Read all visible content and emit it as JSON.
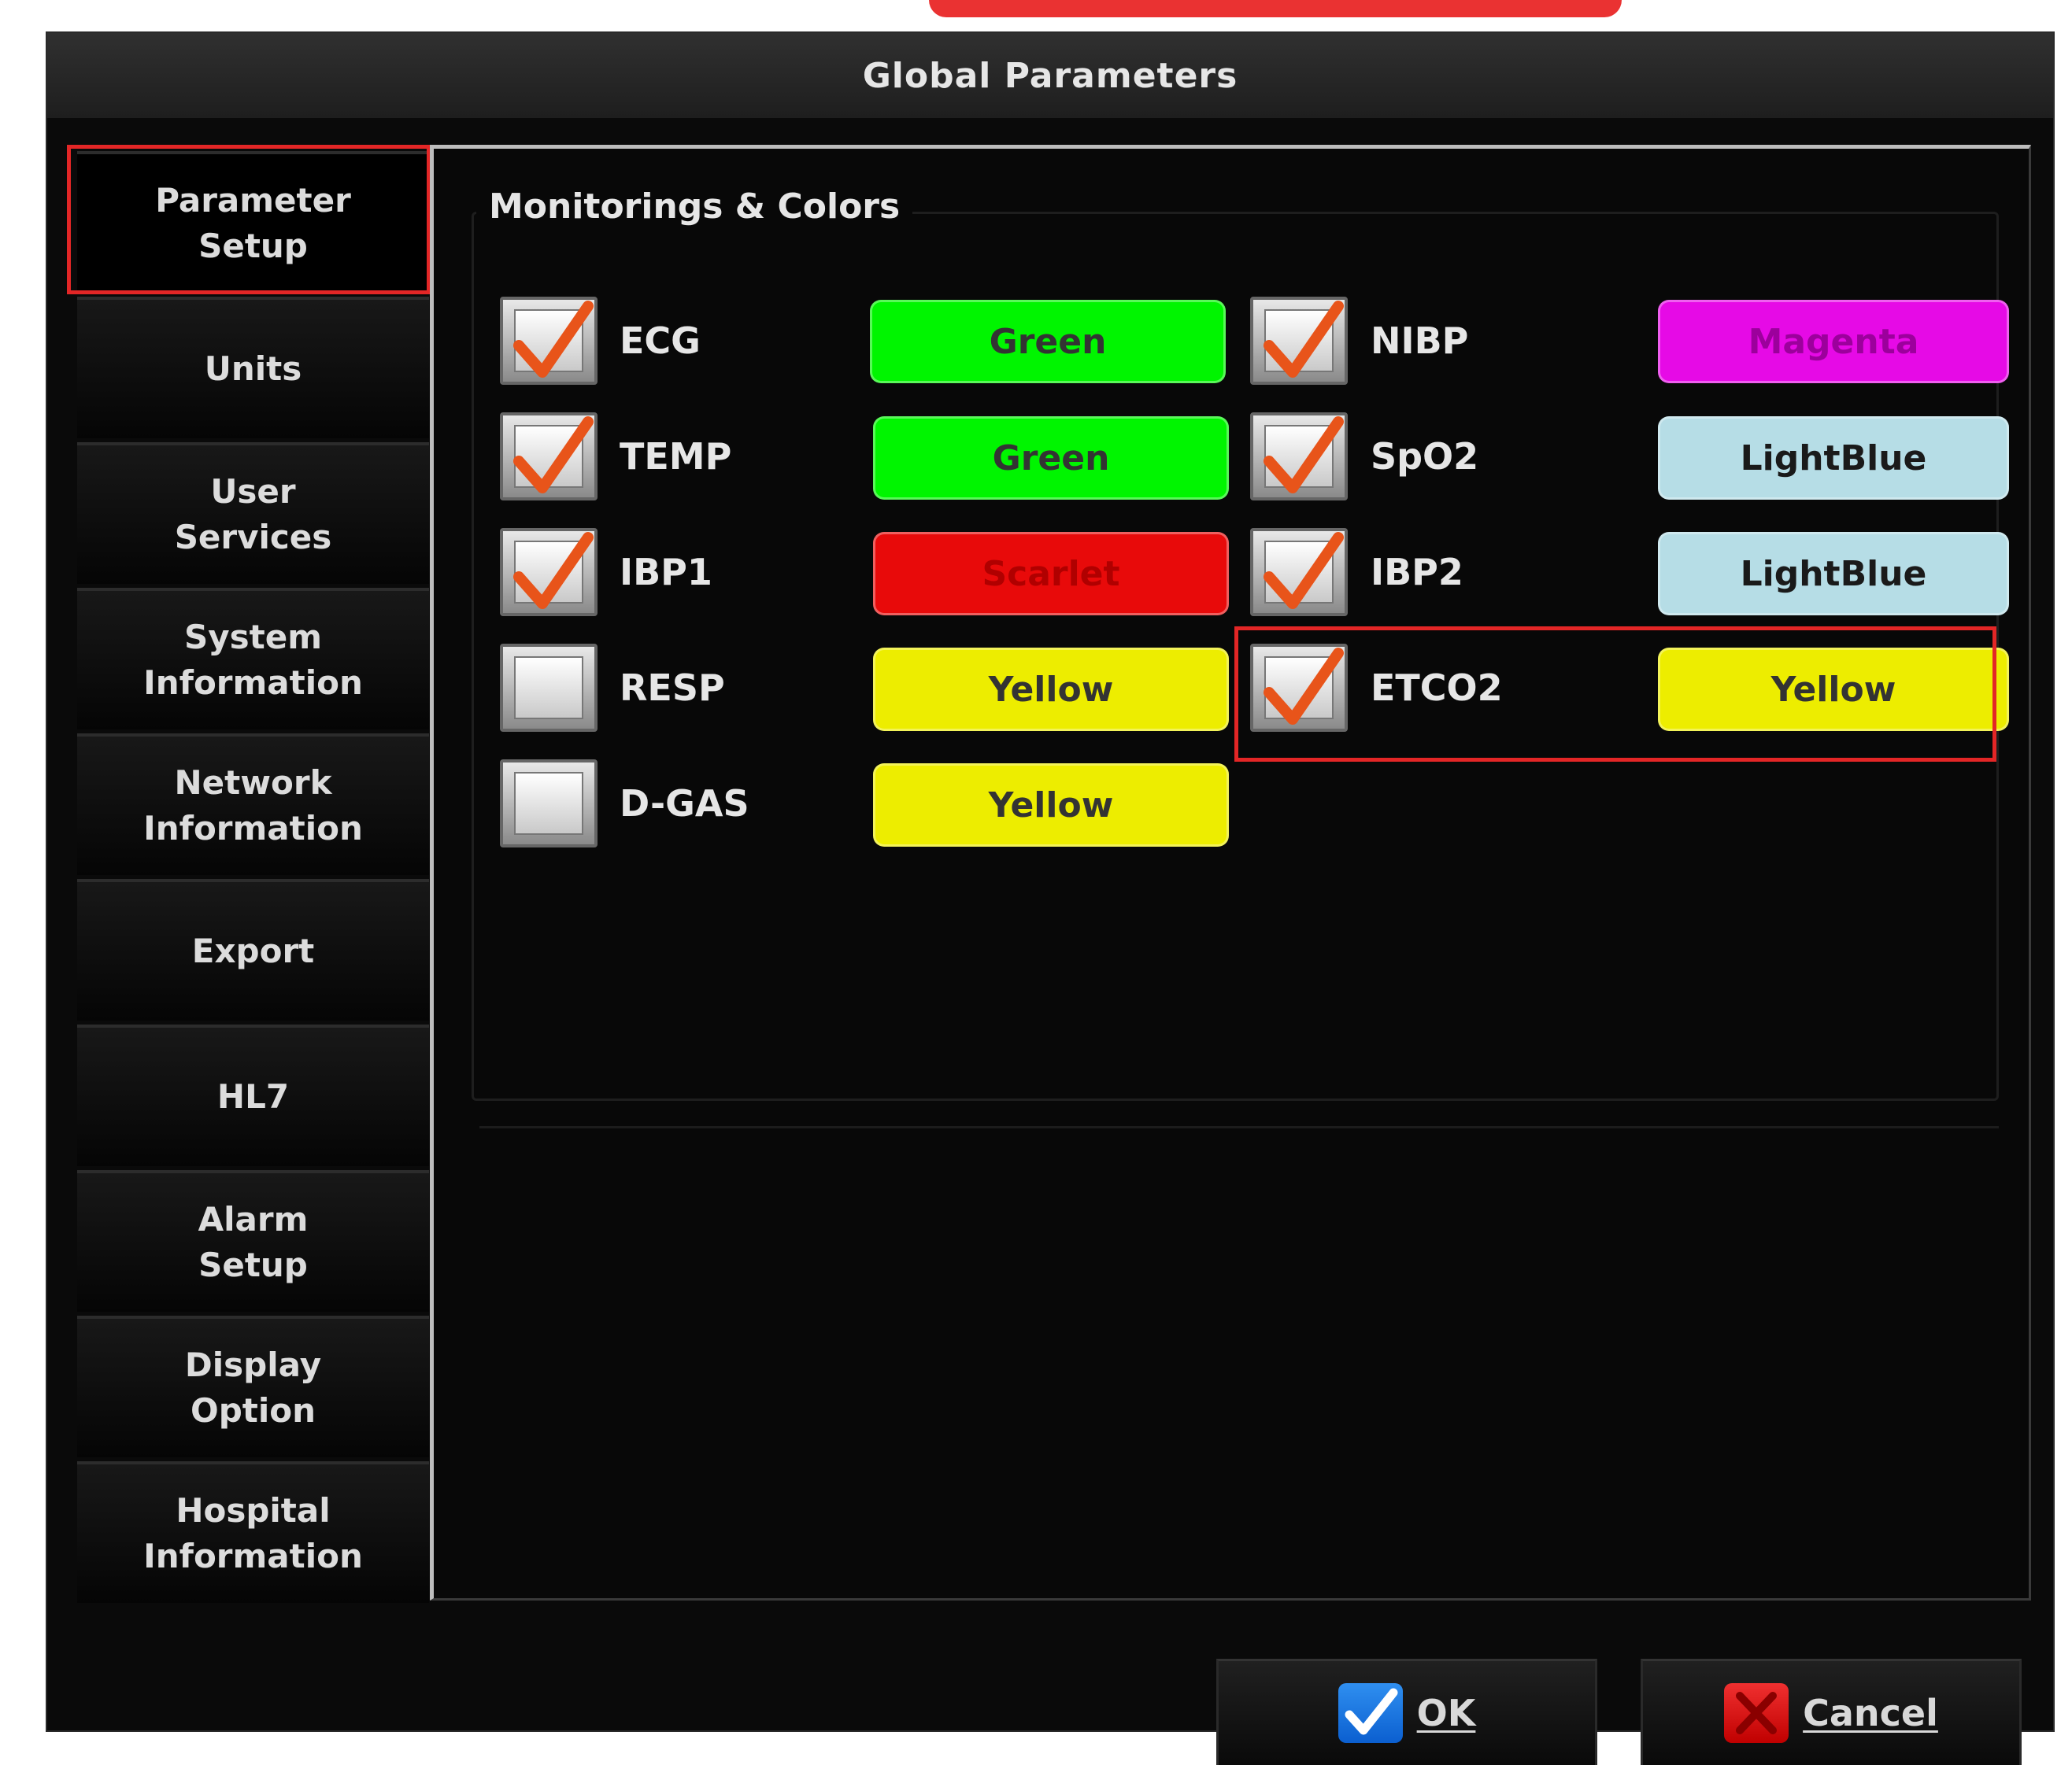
{
  "window": {
    "title": "Global Parameters"
  },
  "sidebar": {
    "items": [
      {
        "label": "Parameter\nSetup",
        "active": true
      },
      {
        "label": "Units"
      },
      {
        "label": "User\nServices"
      },
      {
        "label": "System\nInformation"
      },
      {
        "label": "Network\nInformation"
      },
      {
        "label": "Export"
      },
      {
        "label": "HL7"
      },
      {
        "label": "Alarm\nSetup"
      },
      {
        "label": "Display\nOption"
      },
      {
        "label": "Hospital\nInformation"
      }
    ]
  },
  "group": {
    "title": "Monitorings & Colors"
  },
  "params": {
    "ecg": {
      "label": "ECG",
      "checked": true,
      "color_label": "Green",
      "color": "#00f500"
    },
    "temp": {
      "label": "TEMP",
      "checked": true,
      "color_label": "Green",
      "color": "#00f500"
    },
    "ibp1": {
      "label": "IBP1",
      "checked": true,
      "color_label": "Scarlet",
      "color": "#e80a0a"
    },
    "resp": {
      "label": "RESP",
      "checked": false,
      "color_label": "Yellow",
      "color": "#eded00"
    },
    "dgas": {
      "label": "D-GAS",
      "checked": false,
      "color_label": "Yellow",
      "color": "#eded00"
    },
    "nibp": {
      "label": "NIBP",
      "checked": true,
      "color_label": "Magenta",
      "color": "#e60ae6"
    },
    "spo2": {
      "label": "SpO2",
      "checked": true,
      "color_label": "LightBlue",
      "color": "#b6dde6"
    },
    "ibp2": {
      "label": "IBP2",
      "checked": true,
      "color_label": "LightBlue",
      "color": "#b6dde6"
    },
    "etco2": {
      "label": "ETCO2",
      "checked": true,
      "color_label": "Yellow",
      "color": "#eded00"
    }
  },
  "footer": {
    "ok_label": "OK",
    "cancel_label": "Cancel"
  },
  "colors": {
    "highlight": "#e32626",
    "check": "#e8541a"
  }
}
